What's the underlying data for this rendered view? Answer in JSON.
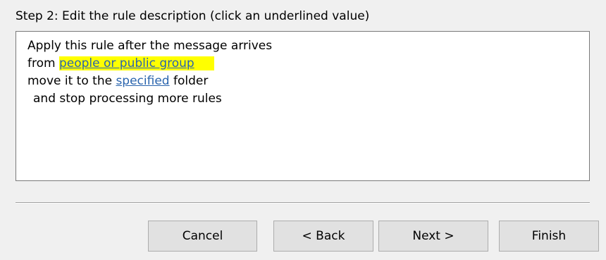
{
  "step": {
    "label": "Step 2: Edit the rule description (click an underlined value)"
  },
  "rule_description": {
    "line1": "Apply this rule after the message arrives",
    "line2_prefix": "from ",
    "line2_link": "people or public group",
    "line3_prefix": "move it to the ",
    "line3_link": "specified",
    "line3_suffix": " folder",
    "line4": "and stop processing more rules"
  },
  "buttons": {
    "cancel": "Cancel",
    "back": "< Back",
    "next": "Next >",
    "finish": "Finish"
  },
  "colors": {
    "link": "#2a64ad",
    "highlight": "#ffff00",
    "dialog_background": "#f0f0f0"
  }
}
